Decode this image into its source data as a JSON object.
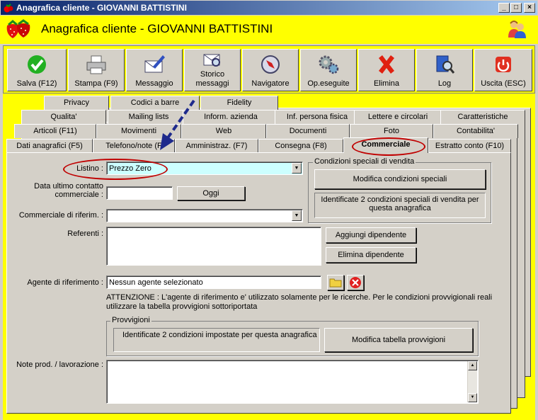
{
  "window": {
    "title": "Anagrafica cliente - GIOVANNI BATTISTINI",
    "minimize": "_",
    "maximize": "□",
    "close": "×"
  },
  "header": {
    "title": "Anagrafica cliente - GIOVANNI BATTISTINI"
  },
  "toolbar": {
    "save": "Salva (F12)",
    "print": "Stampa (F9)",
    "message": "Messaggio",
    "history_1": "Storico",
    "history_2": "messaggi",
    "navigator": "Navigatore",
    "operations": "Op.eseguite",
    "delete": "Elimina",
    "log": "Log",
    "exit": "Uscita (ESC)"
  },
  "tabs": {
    "row1": [
      "Privacy",
      "Codici a barre",
      "Fidelity"
    ],
    "row2": [
      "Qualita'",
      "Mailing lists",
      "Inform. azienda",
      "Inf. persona fisica",
      "Lettere e circolari",
      "Caratteristiche"
    ],
    "row3": [
      "Articoli (F11)",
      "Movimenti",
      "Web",
      "Documenti",
      "Foto",
      "Contabilita'"
    ],
    "row4": [
      "Dati anagrafici (F5)",
      "Telefono/note (F",
      "Amministraz. (F7)",
      "Consegna (F8)",
      "Commerciale",
      "Estratto conto (F10)"
    ]
  },
  "form": {
    "listino_label": "Listino :",
    "listino_value": "Prezzo Zero",
    "last_contact_label_1": "Data ultimo contatto",
    "last_contact_label_2": "commerciale :",
    "last_contact_value": "",
    "today_button": "Oggi",
    "salesperson_label": "Commerciale di riferim. :",
    "salesperson_value": "",
    "contacts_label": "Referenti :",
    "add_employee": "Aggiungi dipendente",
    "remove_employee": "Elimina dipendente",
    "agent_label": "Agente di riferimento :",
    "agent_value": "Nessun agente selezionato",
    "warning_1": "ATTENZIONE : L'agente di riferimento e' utilizzato solamente per le ricerche. Per le condizioni provvigionali reali",
    "warning_2": "utilizzare la tabella provvigioni sottoriportata",
    "notes_label": "Note prod. / lavorazione :",
    "notes_value": ""
  },
  "special_conditions": {
    "title": "Condizioni speciali di vendita",
    "button": "Modifica condizioni speciali",
    "info_1": "Identificate 2 condizioni speciali di vendita per",
    "info_2": "questa anagrafica"
  },
  "commissions": {
    "title": "Provvigioni",
    "info": "Identificate 2 condizioni impostate per questa anagrafica",
    "button": "Modifica tabella provvigioni"
  },
  "colors": {
    "accent": "#ffff00",
    "highlight": "#c00000",
    "arrow": "#1e2a8c",
    "listino_field": "#ccffff"
  }
}
